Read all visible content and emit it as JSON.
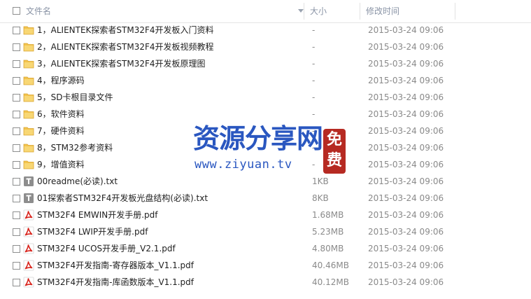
{
  "header": {
    "name_label": "文件名",
    "size_label": "大小",
    "date_label": "修改时间"
  },
  "files": [
    {
      "type": "folder",
      "name": "1，ALIENTEK探索者STM32F4开发板入门资料",
      "size": "-",
      "date": "2015-03-24 09:06"
    },
    {
      "type": "folder",
      "name": "2，ALIENTEK探索者STM32F4开发板视频教程",
      "size": "-",
      "date": "2015-03-24 09:06"
    },
    {
      "type": "folder",
      "name": "3，ALIENTEK探索者STM32F4开发板原理图",
      "size": "-",
      "date": "2015-03-24 09:06"
    },
    {
      "type": "folder",
      "name": "4，程序源码",
      "size": "-",
      "date": "2015-03-24 09:06"
    },
    {
      "type": "folder",
      "name": "5，SD卡根目录文件",
      "size": "-",
      "date": "2015-03-24 09:06"
    },
    {
      "type": "folder",
      "name": "6，软件资料",
      "size": "-",
      "date": "2015-03-24 09:06"
    },
    {
      "type": "folder",
      "name": "7，硬件资料",
      "size": "-",
      "date": "2015-03-24 09:06"
    },
    {
      "type": "folder",
      "name": "8，STM32参考资料",
      "size": "-",
      "date": "2015-03-24 09:06"
    },
    {
      "type": "folder",
      "name": "9，增值资料",
      "size": "-",
      "date": "2015-03-24 09:06"
    },
    {
      "type": "txt",
      "name": "00readme(必读).txt",
      "size": "1KB",
      "date": "2015-03-24 09:06"
    },
    {
      "type": "txt",
      "name": "01探索者STM32F4开发板光盘结构(必读).txt",
      "size": "8KB",
      "date": "2015-03-24 09:06"
    },
    {
      "type": "pdf",
      "name": "STM32F4 EMWIN开发手册.pdf",
      "size": "1.68MB",
      "date": "2015-03-24 09:06"
    },
    {
      "type": "pdf",
      "name": "STM32F4 LWIP开发手册.pdf",
      "size": "5.23MB",
      "date": "2015-03-24 09:06"
    },
    {
      "type": "pdf",
      "name": "STM32F4 UCOS开发手册_V2.1.pdf",
      "size": "4.80MB",
      "date": "2015-03-24 09:06"
    },
    {
      "type": "pdf",
      "name": "STM32F4开发指南-寄存器版本_V1.1.pdf",
      "size": "40.46MB",
      "date": "2015-03-24 09:06"
    },
    {
      "type": "pdf",
      "name": "STM32F4开发指南-库函数版本_V1.1.pdf",
      "size": "40.12MB",
      "date": "2015-03-24 09:06"
    }
  ],
  "watermark": {
    "title": "资源分享网",
    "url": "www.ziyuan.tv",
    "seal": [
      "免",
      "费"
    ]
  },
  "colors": {
    "header_text": "#8a94a6",
    "folder": "#f3c34d",
    "txt_icon": "#8d8d8d",
    "pdf_icon": "#d8231b",
    "watermark": "#2a57c0",
    "seal": "#b62a22"
  }
}
